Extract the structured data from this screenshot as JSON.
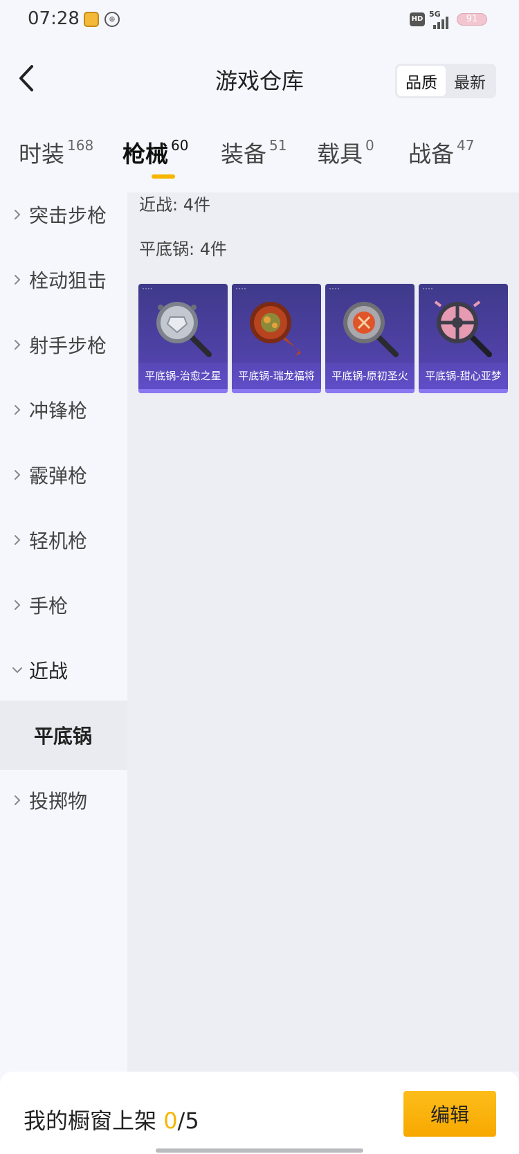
{
  "status_bar": {
    "time": "07:28",
    "network": "5G",
    "hd_badge": "HD",
    "battery": "91"
  },
  "header": {
    "title": "游戏仓库",
    "back_icon": "chevron-left-icon",
    "sort_options": [
      {
        "label": "品质",
        "active": true
      },
      {
        "label": "最新",
        "active": false
      }
    ]
  },
  "tabs": [
    {
      "label": "时装",
      "count": "168"
    },
    {
      "label": "枪械",
      "count": "60",
      "active": true
    },
    {
      "label": "装备",
      "count": "51"
    },
    {
      "label": "载具",
      "count": "0"
    },
    {
      "label": "战备",
      "count": "47"
    }
  ],
  "sidebar": {
    "items": [
      {
        "label": "突击步枪"
      },
      {
        "label": "栓动狙击"
      },
      {
        "label": "射手步枪"
      },
      {
        "label": "冲锋枪"
      },
      {
        "label": "霰弹枪"
      },
      {
        "label": "轻机枪"
      },
      {
        "label": "手枪"
      },
      {
        "label": "近战",
        "expanded": true
      },
      {
        "label": "投掷物"
      }
    ],
    "selected_sub": "平底锅"
  },
  "content": {
    "category_summary": "近战: 4件",
    "subcategory_summary": "平底锅: 4件",
    "items": [
      {
        "name": "平底锅-治愈之星",
        "pan_color": "#9ea3ad",
        "accent": "#d7dbe3"
      },
      {
        "name": "平底锅-瑞龙福将",
        "pan_color": "#b8431f",
        "accent": "#e6a23a"
      },
      {
        "name": "平底锅-原初圣火",
        "pan_color": "#8f8f96",
        "accent": "#e0542a"
      },
      {
        "name": "平底锅-甜心亚梦",
        "pan_color": "#3d3d49",
        "accent": "#e79bb3"
      }
    ]
  },
  "bottom_bar": {
    "shelf_label": "我的橱窗上架",
    "shelf_current": "0",
    "shelf_separator": "/",
    "shelf_total": "5",
    "edit_label": "编辑"
  },
  "colors": {
    "accent_yellow": "#f7b500",
    "card_purple": "#4a3f9e"
  }
}
